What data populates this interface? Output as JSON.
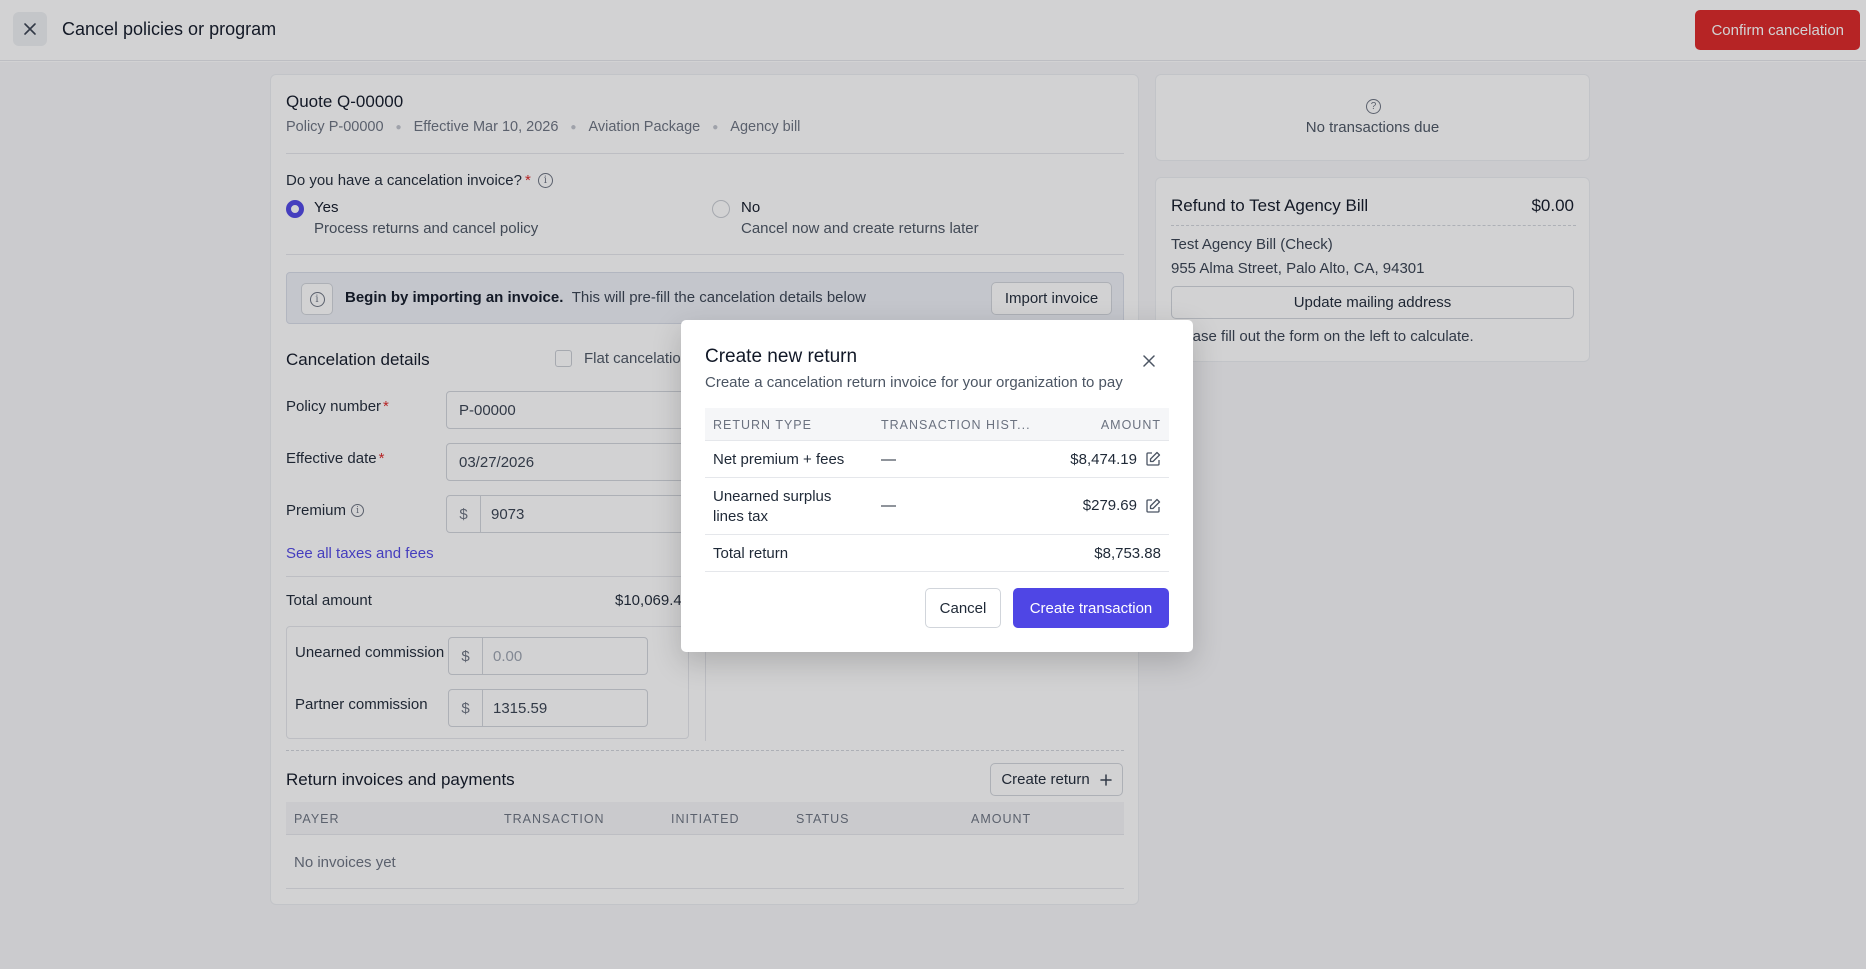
{
  "header": {
    "title": "Cancel policies or program",
    "confirm_label": "Confirm cancelation"
  },
  "quote": {
    "title": "Quote Q-00000",
    "policy": "Policy P-00000",
    "effective": "Effective Mar 10, 2026",
    "package": "Aviation Package",
    "billing": "Agency bill"
  },
  "invoice_question": {
    "label": "Do you have a cancelation invoice?",
    "required_mark": "*",
    "options": [
      {
        "title": "Yes",
        "subtitle": "Process returns and cancel policy",
        "selected": true
      },
      {
        "title": "No",
        "subtitle": "Cancel now and create returns later",
        "selected": false
      }
    ]
  },
  "banner": {
    "bold": "Begin by importing an invoice.",
    "text": "This will pre-fill the cancelation details below",
    "button": "Import invoice"
  },
  "cancelation": {
    "title": "Cancelation details",
    "flat_label": "Flat cancelation",
    "policy_number_label": "Policy number",
    "policy_number_value": "P-00000",
    "effective_date_label": "Effective date",
    "effective_date_value": "03/27/2026",
    "premium_label": "Premium",
    "premium_value": "9073",
    "currency": "$",
    "taxes_link": "See all taxes and fees",
    "total_label": "Total amount",
    "total_value": "$10,069.47",
    "unearned_commission_label": "Unearned commission",
    "unearned_commission_placeholder": "0.00",
    "partner_commission_label": "Partner commission",
    "partner_commission_value": "1315.59",
    "required_mark": "*"
  },
  "returns": {
    "title": "Return invoices and payments",
    "create_button": "Create return",
    "columns": [
      "PAYER",
      "TRANSACTION",
      "INITIATED",
      "STATUS",
      "AMOUNT"
    ],
    "empty": "No invoices yet"
  },
  "right": {
    "no_transactions": "No transactions due",
    "refund_title": "Refund to Test Agency Bill",
    "refund_amount": "$0.00",
    "payee": "Test Agency Bill (Check)",
    "address": "955 Alma Street, Palo Alto, CA, 94301",
    "update_button": "Update mailing address",
    "hint": "Please fill out the form on the left to calculate."
  },
  "modal": {
    "title": "Create new return",
    "subtitle": "Create a cancelation return invoice for your organization to pay",
    "columns": [
      "RETURN TYPE",
      "TRANSACTION HIST...",
      "AMOUNT"
    ],
    "rows": [
      {
        "type": "Net premium + fees",
        "history": "—",
        "amount": "$8,474.19"
      },
      {
        "type_line1": "Unearned surplus",
        "type_line2": "lines tax",
        "history": "—",
        "amount": "$279.69"
      }
    ],
    "total_label": "Total return",
    "total_value": "$8,753.88",
    "cancel": "Cancel",
    "create": "Create transaction"
  },
  "icons": {
    "close": "close-icon",
    "info": "info-icon",
    "help": "question-icon",
    "plus": "plus-icon",
    "edit": "edit-icon"
  },
  "colors": {
    "danger": "#dc2626",
    "accent": "#4f46e5"
  }
}
